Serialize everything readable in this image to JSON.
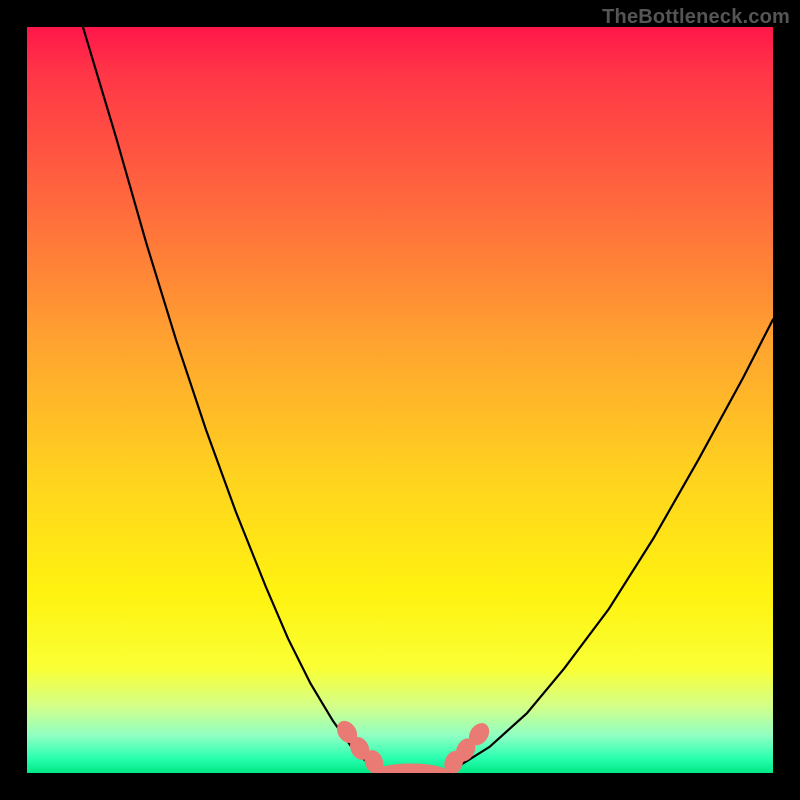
{
  "watermark": "TheBottleneck.com",
  "colors": {
    "frame": "#000000",
    "gradient_top": "#ff164a",
    "gradient_bottom": "#00e885",
    "curve": "#000000",
    "marker": "#e97b74"
  },
  "chart_data": {
    "type": "line",
    "title": "",
    "xlabel": "",
    "ylabel": "",
    "xlim": [
      0,
      100
    ],
    "ylim": [
      0,
      100
    ],
    "note": "V-shaped bottleneck curve; y=0 is best (green), y=100 is worst (red). Values estimated from pixel positions.",
    "series": [
      {
        "name": "left-branch",
        "x": [
          7.5,
          12,
          16,
          20,
          24,
          28,
          32,
          35,
          38,
          41,
          43.5,
          46
        ],
        "y": [
          100,
          85,
          71,
          58,
          46,
          35,
          25,
          18,
          12,
          7,
          3.5,
          1
        ]
      },
      {
        "name": "flat-bottom",
        "x": [
          46,
          48,
          50,
          52,
          54,
          56,
          58
        ],
        "y": [
          1,
          0.3,
          0,
          0,
          0,
          0.3,
          1
        ]
      },
      {
        "name": "right-branch",
        "x": [
          58,
          62,
          67,
          72,
          78,
          84,
          90,
          96,
          100
        ],
        "y": [
          1,
          3.5,
          8,
          14,
          22,
          31.5,
          42,
          53,
          60.8
        ]
      }
    ],
    "markers": {
      "name": "highlight-points",
      "x": [
        42.9,
        44.6,
        46.5,
        51.5,
        57.2,
        58.8,
        60.6
      ],
      "y": [
        5.5,
        3.3,
        1.5,
        0.2,
        1.4,
        3.1,
        5.2
      ],
      "style": "oval"
    }
  }
}
